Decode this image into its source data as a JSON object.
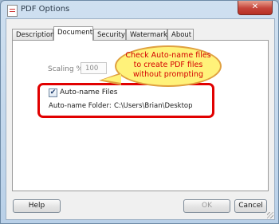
{
  "window": {
    "title": "PDF Options",
    "close_glyph": "✕"
  },
  "tabs": [
    {
      "label": "Description"
    },
    {
      "label": "Document"
    },
    {
      "label": "Security"
    },
    {
      "label": "Watermark"
    },
    {
      "label": "About"
    }
  ],
  "active_tab": "Document",
  "document": {
    "scaling_label": "Scaling %",
    "scaling_value": "100",
    "auto_name_checked": true,
    "auto_name_check_glyph": "✔",
    "auto_name_label": "Auto-name Files",
    "auto_name_folder_label": "Auto-name Folder:",
    "auto_name_folder_value": "C:\\Users\\Brian\\Desktop"
  },
  "callout": {
    "lines": [
      "Check Auto-name files",
      "to create PDF files",
      "without prompting"
    ]
  },
  "buttons": {
    "help": "Help",
    "ok": "OK",
    "cancel": "Cancel"
  },
  "colors": {
    "highlight_border": "#e10000",
    "callout_fill": "#fff27a",
    "callout_text": "#d40000"
  }
}
